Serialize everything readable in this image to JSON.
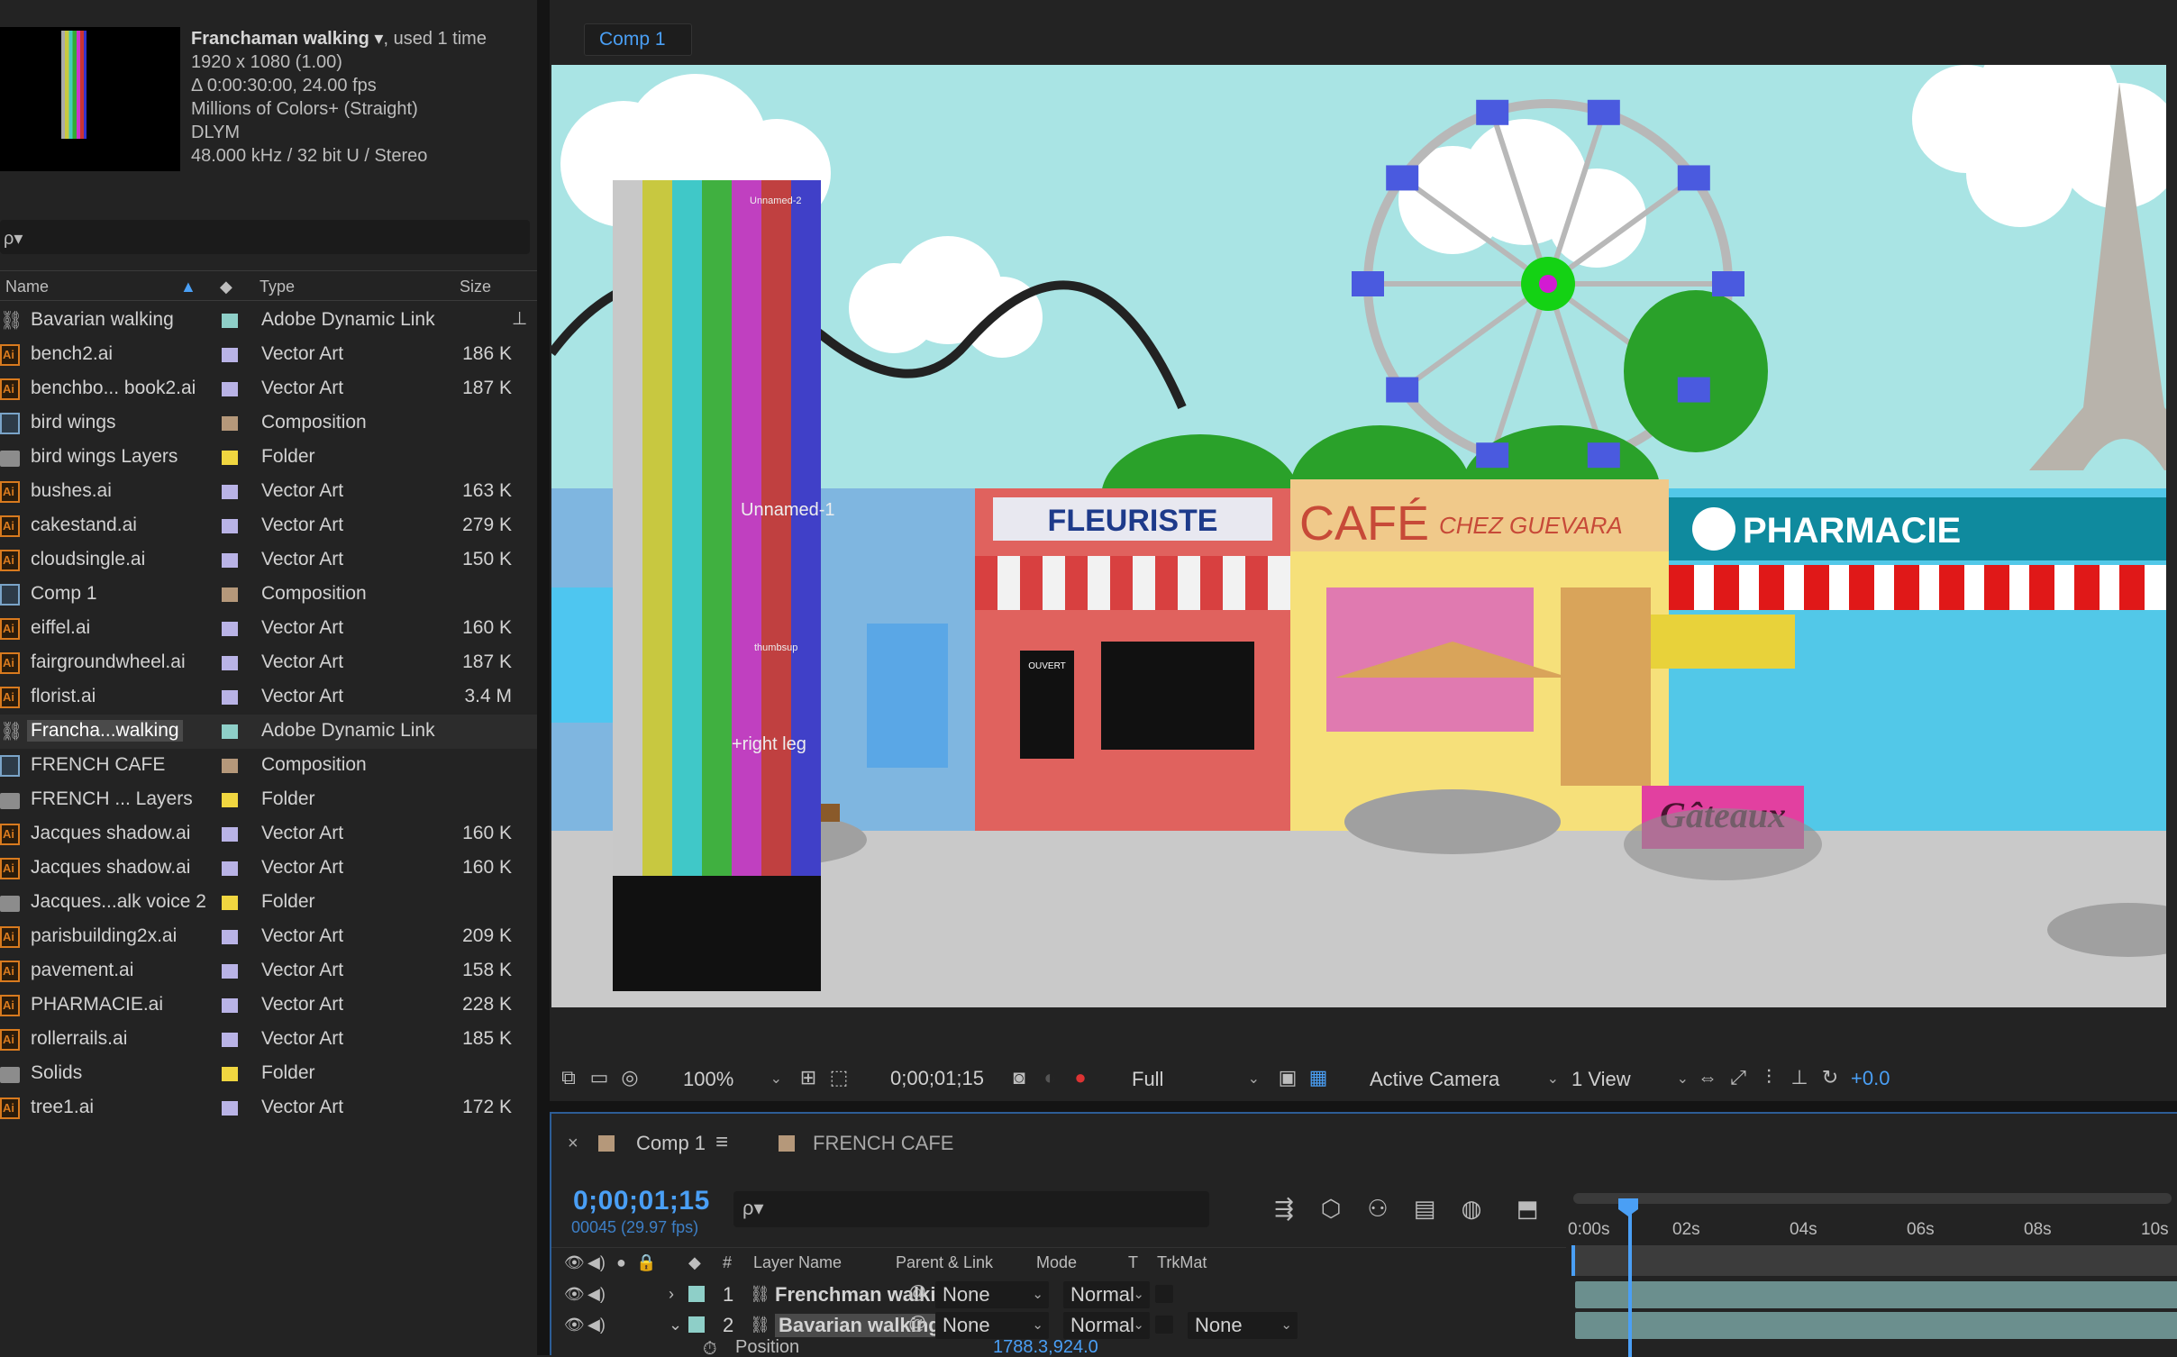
{
  "project": {
    "footage": {
      "name": "Franchaman walking",
      "used": ", used 1 time",
      "dims": "1920 x 1080 (1.00)",
      "duration": "Δ 0:00:30:00, 24.00 fps",
      "colors": "Millions of Colors+ (Straight)",
      "codec": "DLYM",
      "audio": "48.000 kHz / 32 bit U / Stereo"
    },
    "search_icon": "ρ▾",
    "columns": {
      "name": "Name",
      "type": "Type",
      "size": "Size"
    },
    "label_colors": {
      "aqua": "#8ecfc8",
      "lavender": "#b9b3e6",
      "sandstone": "#b5987a",
      "yellow": "#f0d640"
    },
    "items": [
      {
        "icon": "link-icon",
        "name": "Bavarian walking",
        "color": "#8ecfc8",
        "type": "Adobe Dynamic Link",
        "size": ""
      },
      {
        "icon": "ai-file-icon",
        "name": "bench2.ai",
        "color": "#b9b3e6",
        "type": "Vector Art",
        "size": "186 K"
      },
      {
        "icon": "ai-file-icon",
        "name": "benchbo... book2.ai",
        "color": "#b9b3e6",
        "type": "Vector Art",
        "size": "187 K"
      },
      {
        "icon": "composition-icon",
        "name": "bird wings",
        "color": "#b5987a",
        "type": "Composition",
        "size": ""
      },
      {
        "icon": "folder-icon",
        "name": "bird wings Layers",
        "color": "#f0d640",
        "type": "Folder",
        "size": ""
      },
      {
        "icon": "ai-file-icon",
        "name": "bushes.ai",
        "color": "#b9b3e6",
        "type": "Vector Art",
        "size": "163 K"
      },
      {
        "icon": "ai-file-icon",
        "name": "cakestand.ai",
        "color": "#b9b3e6",
        "type": "Vector Art",
        "size": "279 K"
      },
      {
        "icon": "ai-file-icon",
        "name": "cloudsingle.ai",
        "color": "#b9b3e6",
        "type": "Vector Art",
        "size": "150 K"
      },
      {
        "icon": "composition-icon",
        "name": "Comp 1",
        "color": "#b5987a",
        "type": "Composition",
        "size": ""
      },
      {
        "icon": "ai-file-icon",
        "name": "eiffel.ai",
        "color": "#b9b3e6",
        "type": "Vector Art",
        "size": "160 K"
      },
      {
        "icon": "ai-file-icon",
        "name": "fairgroundwheel.ai",
        "color": "#b9b3e6",
        "type": "Vector Art",
        "size": "187 K"
      },
      {
        "icon": "ai-file-icon",
        "name": "florist.ai",
        "color": "#b9b3e6",
        "type": "Vector Art",
        "size": "3.4 M"
      },
      {
        "icon": "link-icon",
        "name": "Francha...walking",
        "color": "#8ecfc8",
        "type": "Adobe Dynamic Link",
        "size": ""
      },
      {
        "icon": "composition-icon",
        "name": "FRENCH CAFE",
        "color": "#b5987a",
        "type": "Composition",
        "size": ""
      },
      {
        "icon": "folder-icon",
        "name": "FRENCH ... Layers",
        "color": "#f0d640",
        "type": "Folder",
        "size": ""
      },
      {
        "icon": "ai-file-icon",
        "name": "Jacques shadow.ai",
        "color": "#b9b3e6",
        "type": "Vector Art",
        "size": "160 K"
      },
      {
        "icon": "ai-file-icon",
        "name": "Jacques shadow.ai",
        "color": "#b9b3e6",
        "type": "Vector Art",
        "size": "160 K"
      },
      {
        "icon": "folder-icon",
        "name": "Jacques...alk voice 2",
        "color": "#f0d640",
        "type": "Folder",
        "size": ""
      },
      {
        "icon": "ai-file-icon",
        "name": "parisbuilding2x.ai",
        "color": "#b9b3e6",
        "type": "Vector Art",
        "size": "209 K"
      },
      {
        "icon": "ai-file-icon",
        "name": "pavement.ai",
        "color": "#b9b3e6",
        "type": "Vector Art",
        "size": "158 K"
      },
      {
        "icon": "ai-file-icon",
        "name": "PHARMACIE.ai",
        "color": "#b9b3e6",
        "type": "Vector Art",
        "size": "228 K"
      },
      {
        "icon": "ai-file-icon",
        "name": "rollerrails.ai",
        "color": "#b9b3e6",
        "type": "Vector Art",
        "size": "185 K"
      },
      {
        "icon": "folder-icon",
        "name": "Solids",
        "color": "#f0d640",
        "type": "Folder",
        "size": ""
      },
      {
        "icon": "ai-file-icon",
        "name": "tree1.ai",
        "color": "#b9b3e6",
        "type": "Vector Art",
        "size": "172 K"
      }
    ],
    "selected_index": 12
  },
  "viewer": {
    "tab": "Comp 1",
    "scene": {
      "fleuriste": "FLEURISTE",
      "cafe": "CAFÉ",
      "cafe_sub": "CHEZ GUEVARA",
      "pharmacie": "PHARMACIE",
      "gateaux": "Gâteaux",
      "ouvert": "OUVERT",
      "unnamed1": "Unnamed-1",
      "unnamed2": "Unnamed-2",
      "right_leg": "+right leg",
      "thumbsup": "thumbsup"
    },
    "toolbar": {
      "zoom": "100%",
      "timecode": "0;00;01;15",
      "resolution": "Full",
      "camera": "Active Camera",
      "views": "1 View",
      "exposure": "+0.0"
    }
  },
  "timeline": {
    "tabs": [
      {
        "label": "Comp 1",
        "color": "#b5987a"
      },
      {
        "label": "FRENCH CAFE",
        "color": "#b5987a"
      }
    ],
    "timecode": "0;00;01;15",
    "fps": "00045 (29.97 fps)",
    "ruler": [
      "0:00s",
      "02s",
      "04s",
      "06s",
      "08s",
      "10s"
    ],
    "columns": {
      "num": "#",
      "layer_name": "Layer Name",
      "parent": "Parent & Link",
      "mode": "Mode",
      "t": "T",
      "trkmat": "TrkMat"
    },
    "layers": [
      {
        "index": "1",
        "name": "Frenchman walking",
        "parent": "None",
        "mode": "Normal",
        "trkmat": "",
        "color": "#8ecfc8"
      },
      {
        "index": "2",
        "name": "Bavarian walking",
        "parent": "None",
        "mode": "Normal",
        "trkmat": "None",
        "color": "#8ecfc8"
      }
    ],
    "property": {
      "name": "Position",
      "value": "1788.3,924.0"
    }
  }
}
